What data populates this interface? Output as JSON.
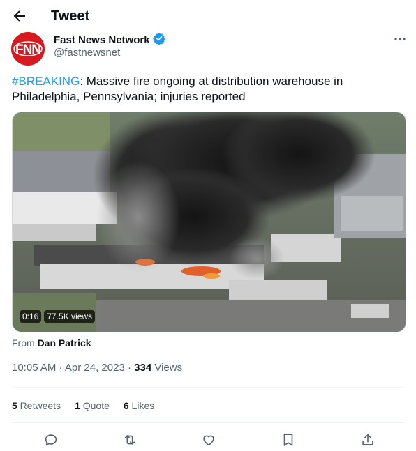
{
  "header": {
    "title": "Tweet"
  },
  "author": {
    "name": "Fast News Network",
    "handle": "@fastnewsnet",
    "avatar_text": "FNN"
  },
  "tweet": {
    "hashtag": "#BREAKING",
    "body": ": Massive fire ongoing at distribution warehouse in Philadelphia, Pennsylvania; injuries reported"
  },
  "video": {
    "duration": "0:16",
    "views": "77.5K views"
  },
  "source": {
    "prefix": "From",
    "name": "Dan Patrick"
  },
  "meta": {
    "time": "10:05 AM",
    "sep1": " · ",
    "date": "Apr 24, 2023",
    "sep2": " · ",
    "views_count": "334",
    "views_label": " Views"
  },
  "stats": {
    "retweets_count": "5",
    "retweets_label": " Retweets",
    "quotes_count": "1",
    "quotes_label": " Quote",
    "likes_count": "6",
    "likes_label": " Likes"
  },
  "actions": [
    "reply-icon",
    "retweet-icon",
    "like-icon",
    "bookmark-icon",
    "share-icon"
  ],
  "colors": {
    "accent": "#1d9bf0",
    "verified": "#1d9bf0",
    "secondary_text": "#536471",
    "avatar_bg": "#d71920"
  }
}
